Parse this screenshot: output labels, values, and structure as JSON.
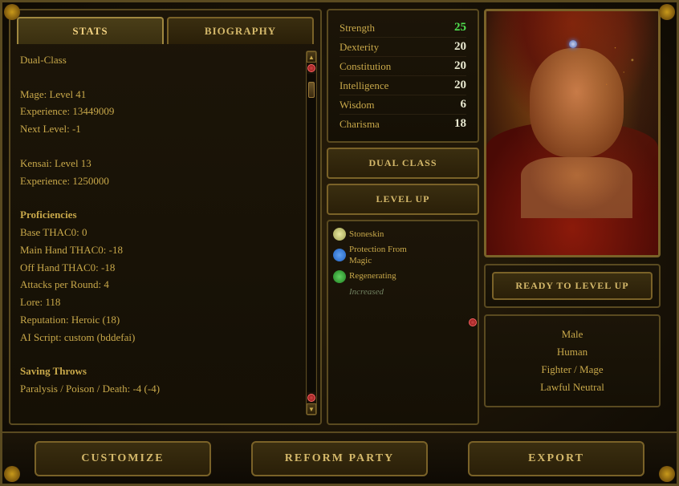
{
  "tabs": {
    "stats": "STATS",
    "biography": "BIOGRAPHY"
  },
  "character": {
    "class": "Dual-Class",
    "mage_level": "Mage: Level 41",
    "mage_exp": "Experience: 13449009",
    "next_level": "Next Level: -1",
    "kensai_level": "Kensai: Level 13",
    "kensai_exp": "Experience: 1250000",
    "proficiencies": "Proficiencies",
    "base_thac0": "Base THAC0: 0",
    "main_thac0": "Main Hand THAC0: -18",
    "off_thac0": "Off Hand THAC0: -18",
    "attacks": "Attacks per Round: 4",
    "lore": "Lore: 118",
    "reputation": "Reputation:  Heroic (18)",
    "ai_script": "AI Script: custom (bddefai)",
    "saving_throws": "Saving Throws",
    "para_save": "Paralysis / Poison / Death: -4 (-4)"
  },
  "attributes": [
    {
      "name": "Strength",
      "value": "25",
      "highlight": true
    },
    {
      "name": "Dexterity",
      "value": "20",
      "highlight": false
    },
    {
      "name": "Constitution",
      "value": "20",
      "highlight": false
    },
    {
      "name": "Intelligence",
      "value": "20",
      "highlight": false
    },
    {
      "name": "Wisdom",
      "value": "6",
      "highlight": false
    },
    {
      "name": "Charisma",
      "value": "18",
      "highlight": false
    }
  ],
  "buttons": {
    "dual_class": "DUAL CLASS",
    "level_up": "LEVEL UP",
    "ready": "Ready to Level Up",
    "customize": "CUSTOMIZE",
    "reform_party": "REFORM PARTY",
    "export": "EXPORT"
  },
  "abilities": [
    {
      "type": "star",
      "text": "Stoneskin",
      "sub": ""
    },
    {
      "type": "blue",
      "text": "Protection From\nMagic",
      "sub": ""
    },
    {
      "type": "green",
      "text": "Regenerating",
      "sub": ""
    },
    {
      "type": null,
      "text": "Increased",
      "sub": "increased"
    }
  ],
  "char_info": {
    "gender": "Male",
    "race": "Human",
    "class": "Fighter / Mage",
    "alignment": "Lawful Neutral"
  }
}
